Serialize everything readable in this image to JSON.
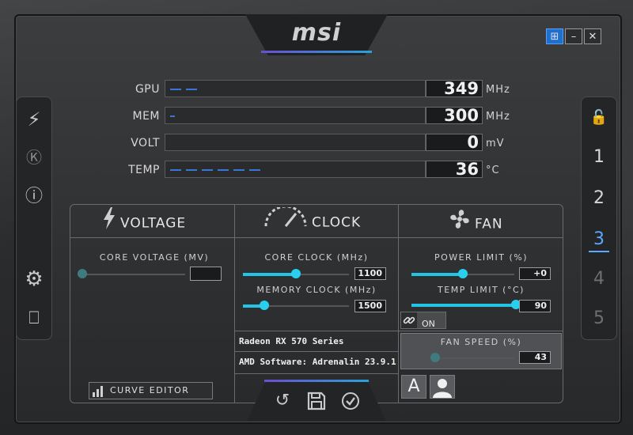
{
  "app": {
    "logo": "msi"
  },
  "window_controls": {
    "windows": "⊞",
    "minimize": "–",
    "close": "✕"
  },
  "left_sidebar": {
    "icons": [
      "kombustor-icon",
      "k-icon",
      "info-icon",
      "settings-icon",
      "monitor-icon"
    ],
    "glyphs": {
      "kombustor": "⚡",
      "k": "Ⓚ",
      "info": "ⓘ",
      "settings": "⚙",
      "monitor": "⎕"
    }
  },
  "right_sidebar": {
    "lock_glyph": "🔓",
    "profiles": [
      "1",
      "2",
      "3",
      "4",
      "5"
    ],
    "active_profile": "3"
  },
  "monitor": {
    "rows": [
      {
        "label": "GPU",
        "value": "349",
        "unit": "MHz",
        "level": 0.12
      },
      {
        "label": "MEM",
        "value": "300",
        "unit": "MHz",
        "level": 0.02
      },
      {
        "label": "VOLT",
        "value": "0",
        "unit": "mV",
        "level": 0.0
      },
      {
        "label": "TEMP",
        "value": "36",
        "unit": "°C",
        "level": 0.36
      }
    ]
  },
  "voltage": {
    "title": "VOLTAGE",
    "core_voltage_label": "CORE VOLTAGE  (MV)",
    "core_voltage_value": ""
  },
  "clock": {
    "title": "CLOCK",
    "core_clock_label": "CORE CLOCK  (MHz)",
    "core_clock_value": "1100",
    "core_clock_fraction": 0.5,
    "memory_clock_label": "MEMORY CLOCK  (MHz)",
    "memory_clock_value": "1500",
    "memory_clock_fraction": 0.2
  },
  "fan": {
    "title": "FAN",
    "power_limit_label": "POWER LIMIT  (%)",
    "power_limit_value": "+0",
    "power_limit_fraction": 0.5,
    "temp_limit_label": "TEMP LIMIT  (°C)",
    "temp_limit_value": "90",
    "temp_limit_fraction": 1.0,
    "link_label": "ON",
    "fan_speed_label": "FAN SPEED  (%)",
    "fan_speed_value": "43",
    "fan_speed_fraction": 0.0,
    "auto_label": "A"
  },
  "gpu_info": {
    "name": "Radeon RX 570 Series",
    "driver": "AMD Software: Adrenalin 23.9.1"
  },
  "curve_editor": {
    "label": "CURVE EDITOR"
  },
  "bottom": {
    "reset_glyph": "↺",
    "save_glyph": "💾",
    "apply_glyph": "✓"
  }
}
